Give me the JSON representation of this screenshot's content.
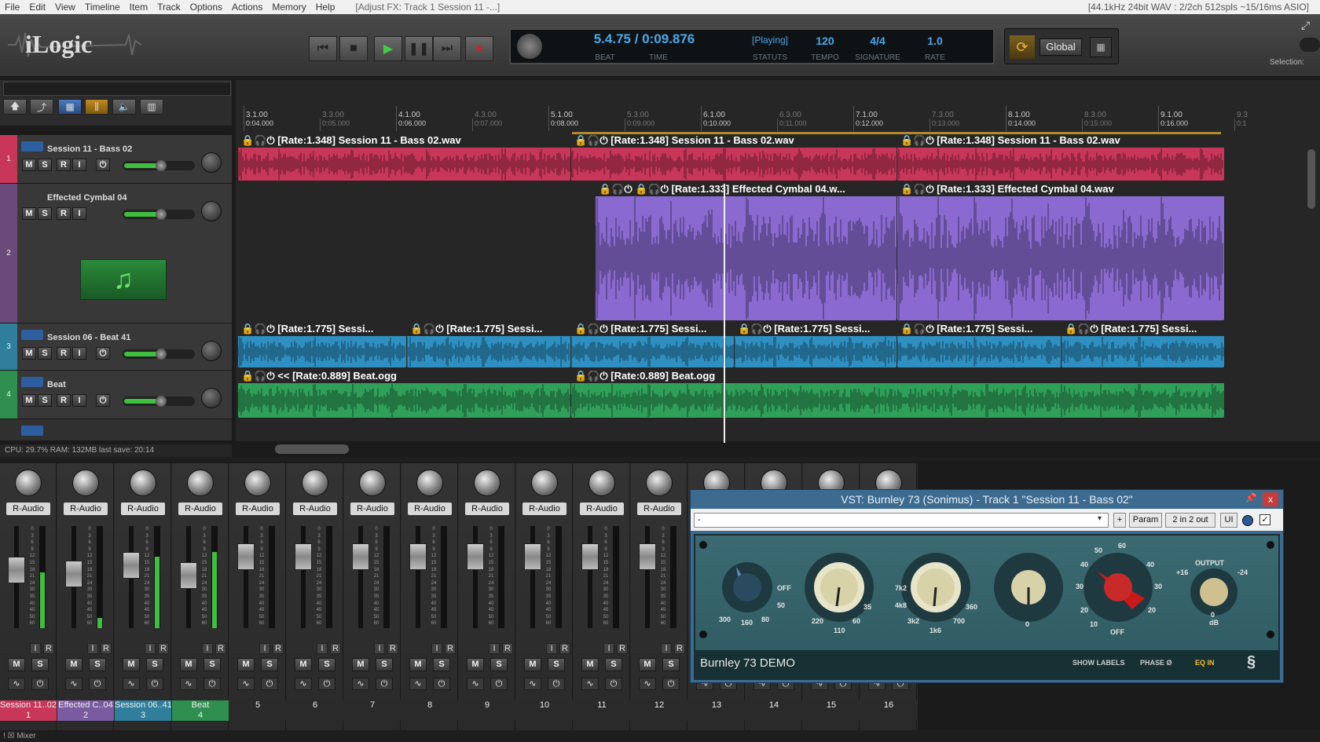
{
  "menu": {
    "items": [
      "File",
      "Edit",
      "View",
      "Timeline",
      "Item",
      "Track",
      "Options",
      "Actions",
      "Memory",
      "Help"
    ],
    "window_title": "[Adjust FX: Track 1 Session 11 -...]",
    "status": "[44.1kHz 24bit WAV : 2/2ch 512spls ~15/16ms ASIO]"
  },
  "brand": {
    "logo": "iLogic"
  },
  "transport": {
    "buttons": [
      "skip-back",
      "stop",
      "play",
      "pause",
      "skip-forward",
      "record"
    ],
    "beat": "5.4.75 / 0:09.876",
    "beat_label": "BEAT",
    "time_label": "TIME",
    "status": "[Playing]",
    "status_label": "STATUTS",
    "tempo": "120",
    "tempo_label": "TEMPO",
    "signature": "4/4",
    "signature_label": "SIGNATURE",
    "rate": "1.0",
    "rate_label": "RATE",
    "global_label": "Global",
    "selection_label": "Selection:"
  },
  "ruler": [
    {
      "bar": "3.1.00",
      "time": "0:04.000",
      "major": true
    },
    {
      "bar": "3.3.00",
      "time": "0:05.000",
      "major": false
    },
    {
      "bar": "4.1.00",
      "time": "0:06.000",
      "major": true
    },
    {
      "bar": "4.3.00",
      "time": "0:07.000",
      "major": false
    },
    {
      "bar": "5.1.00",
      "time": "0:08.000",
      "major": true
    },
    {
      "bar": "5.3.00",
      "time": "0:09.000",
      "major": false
    },
    {
      "bar": "6.1.00",
      "time": "0:10.000",
      "major": true
    },
    {
      "bar": "6.3.00",
      "time": "0:11.000",
      "major": false
    },
    {
      "bar": "7.1.00",
      "time": "0:12.000",
      "major": true
    },
    {
      "bar": "7.3.00",
      "time": "0:13.000",
      "major": false
    },
    {
      "bar": "8.1.00",
      "time": "0:14.000",
      "major": true
    },
    {
      "bar": "8.3.00",
      "time": "0:15.000",
      "major": false
    },
    {
      "bar": "9.1.00",
      "time": "0:16.000",
      "major": true
    },
    {
      "bar": "9.3",
      "time": "0:1",
      "major": false
    }
  ],
  "tracks": [
    {
      "num": "1",
      "name": "Session 11 - Bass 02",
      "color": "#c8365a"
    },
    {
      "num": "2",
      "name": "Effected Cymbal 04",
      "color": "#7a5aa0"
    },
    {
      "num": "3",
      "name": "Session 06 - Beat 41",
      "color": "#2f7f9c"
    },
    {
      "num": "4",
      "name": "Beat",
      "color": "#2f8f50"
    }
  ],
  "track_buttons": [
    "M",
    "S",
    "R",
    "I"
  ],
  "clips": {
    "bass": "[Rate:1.348] Session 11 - Bass 02.wav",
    "cymbal_a": "[Rate:1.333] Effected Cymbal 04.w...",
    "cymbal_b": "[Rate:1.333] Effected Cymbal 04.wav",
    "beat41": "[Rate:1.775] Sessi...",
    "beat_a": "<< [Rate:0.889] Beat.ogg",
    "beat_b": "[Rate:0.889] Beat.ogg"
  },
  "status_bar": "CPU: 29.7%  RAM: 132MB  last save: 20:14",
  "mixer": {
    "route_label": "R-Audio",
    "tab_label": "Mixer",
    "scale": [
      "0",
      "3",
      "6",
      "9",
      "12",
      "15",
      "18",
      "21",
      "24",
      "30",
      "35",
      "40",
      "45",
      "50",
      "60"
    ],
    "strips": [
      {
        "name": "Session 11..02",
        "num": "1",
        "color": "#c8365a",
        "level": 0.55
      },
      {
        "name": "Effected C..04",
        "num": "2",
        "color": "#7a5aa0",
        "level": 0.1
      },
      {
        "name": "Session 06..41",
        "num": "3",
        "color": "#2f7f9c",
        "level": 0.7
      },
      {
        "name": "Beat",
        "num": "4",
        "color": "#2f8f50",
        "level": 0.75
      },
      {
        "name": "",
        "num": "5",
        "color": "#2a2a2a",
        "level": 0
      },
      {
        "name": "",
        "num": "6",
        "color": "#2a2a2a",
        "level": 0
      },
      {
        "name": "",
        "num": "7",
        "color": "#2a2a2a",
        "level": 0
      },
      {
        "name": "",
        "num": "8",
        "color": "#2a2a2a",
        "level": 0
      },
      {
        "name": "",
        "num": "9",
        "color": "#2a2a2a",
        "level": 0
      },
      {
        "name": "",
        "num": "10",
        "color": "#2a2a2a",
        "level": 0
      },
      {
        "name": "",
        "num": "11",
        "color": "#2a2a2a",
        "level": 0
      },
      {
        "name": "",
        "num": "12",
        "color": "#2a2a2a",
        "level": 0
      },
      {
        "name": "",
        "num": "13",
        "color": "#2a2a2a",
        "level": 0
      },
      {
        "name": "",
        "num": "14",
        "color": "#2a2a2a",
        "level": 0
      },
      {
        "name": "",
        "num": "15",
        "color": "#2a2a2a",
        "level": 0
      },
      {
        "name": "",
        "num": "16",
        "color": "#2a2a2a",
        "level": 0
      }
    ]
  },
  "vst": {
    "title": "VST: Burnley 73 (Sonimus) - Track 1 \"Session 11 - Bass 02\"",
    "preset": "-",
    "plus": "+",
    "param": "Param",
    "io": "2 in 2 out",
    "ui": "UI",
    "close": "x",
    "plugin_name": "Burnley 73 DEMO",
    "show_labels": "SHOW LABELS",
    "phase": "PHASE Ø",
    "eq_in": "EQ IN",
    "knob_labels": {
      "hp": [
        "OFF",
        "50",
        "80",
        "160",
        "300"
      ],
      "lo": [
        "35",
        "60",
        "110",
        "220"
      ],
      "mid": [
        "7k2",
        "4k8",
        "3k2",
        "1k6",
        "700",
        "360"
      ],
      "hi": [
        "0"
      ],
      "gain": [
        "60",
        "50",
        "40",
        "30",
        "20",
        "10",
        "OFF",
        "40",
        "30",
        "20"
      ],
      "output": [
        "OUTPUT",
        "+16",
        "-24",
        "0",
        "dB"
      ]
    }
  },
  "colors": {
    "accent": "#4aa8e8",
    "bass": "#c8365a",
    "cymbal": "#8a6ad0",
    "beat41": "#2e8fc0",
    "beat": "#2f9f5a",
    "vst": "#3d6b90"
  }
}
